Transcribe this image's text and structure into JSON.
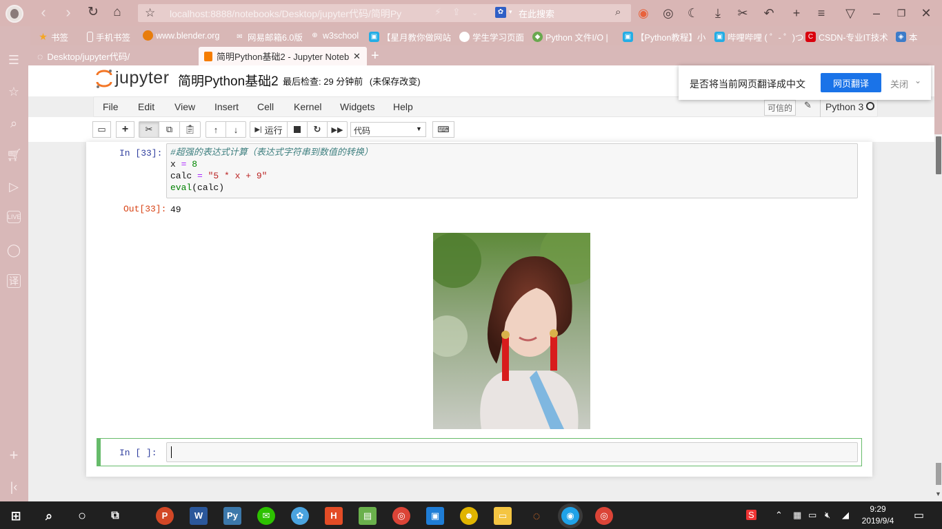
{
  "browser": {
    "url": "localhost:8888/notebooks/Desktop/jupyter代码/简明Py",
    "search_placeholder": "在此搜索",
    "bookmarks": [
      {
        "label": "书签",
        "icon": "star-icon"
      },
      {
        "label": "手机书签",
        "icon": "phone-icon"
      },
      {
        "label": "www.blender.org",
        "icon": "blender-icon"
      },
      {
        "label": "网易邮箱6.0版",
        "icon": "mail-icon"
      },
      {
        "label": "w3school",
        "icon": "w3school-icon"
      },
      {
        "label": "【星月教你做网站",
        "icon": "bilibili-icon"
      },
      {
        "label": "学生学习页面",
        "icon": "circle-icon"
      },
      {
        "label": "Python 文件I/O |",
        "icon": "runoob-icon"
      },
      {
        "label": "【Python教程】小",
        "icon": "bilibili-icon"
      },
      {
        "label": "哔哩哔哩 ( ゜- ゜)つ",
        "icon": "bilibili-icon"
      },
      {
        "label": "CSDN-专业IT技术",
        "icon": "csdn-icon"
      },
      {
        "label": "本",
        "icon": "cube-icon"
      }
    ],
    "tabs": [
      {
        "title": "Desktop/jupyter代码/"
      },
      {
        "title": "简明Python基础2 - Jupyter Notebook"
      }
    ]
  },
  "jupyter": {
    "brand": "jupyter",
    "notebook_name": "简明Python基础2",
    "checkpoint": "最后检查: 29 分钟前",
    "unsaved": "(未保存改变)",
    "menus": [
      "File",
      "Edit",
      "View",
      "Insert",
      "Cell",
      "Kernel",
      "Widgets",
      "Help"
    ],
    "trusted": "可信的",
    "kernel": "Python 3",
    "toolbar": {
      "run_label": "运行",
      "cell_type": "代码"
    }
  },
  "cells": {
    "in33_prompt": "In [33]:",
    "out33_prompt": "Out[33]:",
    "line1": "#超强的表达式计算（表达式字符串到数值的转换）",
    "line2_var": "x",
    "line2_op": " = ",
    "line2_num": "8",
    "line3_var": "calc",
    "line3_op": " = ",
    "line3_str": "\"5 * x + 9\"",
    "line4_fn": "eval",
    "line4_arg": "(calc)",
    "output": "49",
    "new_prompt": "In [ ]:"
  },
  "translate_popup": {
    "question": "是否将当前网页翻译成中文",
    "translate_button": "网页翻译",
    "close": "关闭"
  },
  "taskbar": {
    "time": "9:29",
    "date": "2019/9/4"
  }
}
